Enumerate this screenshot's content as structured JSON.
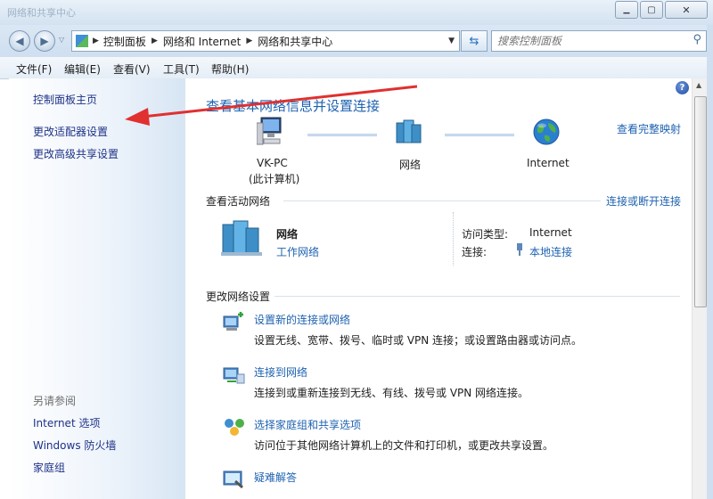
{
  "window": {
    "title": "网络和共享中心",
    "minimize": "▁",
    "maximize": "▢",
    "close": "✕"
  },
  "address": {
    "crumbs": [
      "控制面板",
      "网络和 Internet",
      "网络和共享中心"
    ],
    "search_placeholder": "搜索控制面板"
  },
  "menu": [
    "文件(F)",
    "编辑(E)",
    "查看(V)",
    "工具(T)",
    "帮助(H)"
  ],
  "left": {
    "links": [
      "控制面板主页",
      "更改适配器设置",
      "更改高级共享设置"
    ],
    "see_also_title": "另请参阅",
    "see_also": [
      "Internet 选项",
      "Windows 防火墙",
      "家庭组"
    ]
  },
  "main": {
    "title": "查看基本网络信息并设置连接",
    "full_map": "查看完整映射",
    "map": {
      "pc_name": "VK-PC",
      "pc_sub": "(此计算机)",
      "network": "网络",
      "internet": "Internet"
    },
    "active_header": "查看活动网络",
    "connect_disconnect": "连接或断开连接",
    "active": {
      "name": "网络",
      "type": "工作网络",
      "access_label": "访问类型:",
      "access_value": "Internet",
      "conn_label": "连接:",
      "conn_value": "本地连接"
    },
    "change_header": "更改网络设置",
    "tasks": [
      {
        "title": "设置新的连接或网络",
        "desc": "设置无线、宽带、拨号、临时或 VPN 连接；或设置路由器或访问点。"
      },
      {
        "title": "连接到网络",
        "desc": "连接到或重新连接到无线、有线、拨号或 VPN 网络连接。"
      },
      {
        "title": "选择家庭组和共享选项",
        "desc": "访问位于其他网络计算机上的文件和打印机，或更改共享设置。"
      },
      {
        "title": "疑难解答",
        "desc": ""
      }
    ]
  },
  "colors": {
    "link": "#1e62b0",
    "arrow": "#e03030"
  }
}
